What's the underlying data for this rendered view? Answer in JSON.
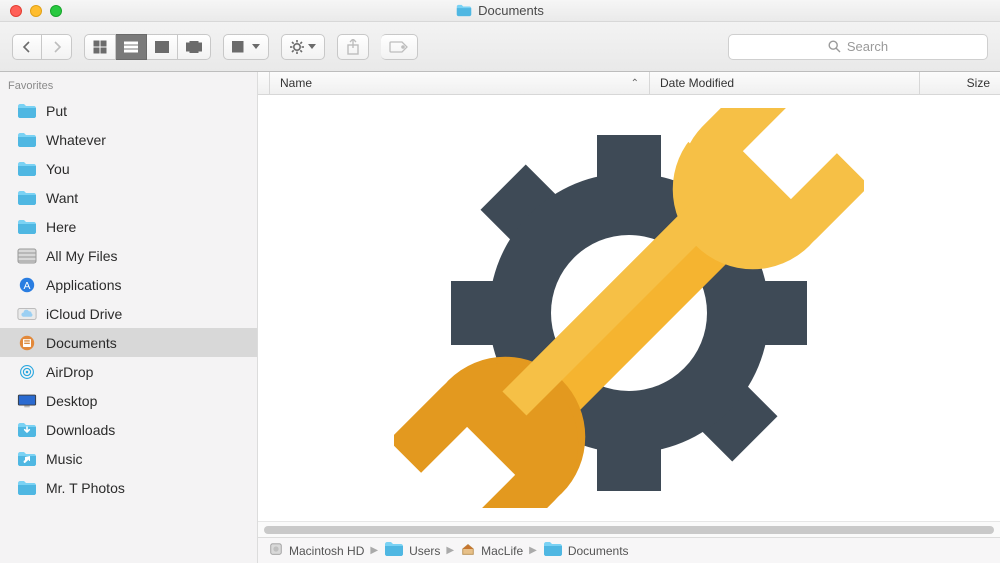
{
  "window": {
    "title": "Documents"
  },
  "search": {
    "placeholder": "Search"
  },
  "columns": {
    "name": "Name",
    "date": "Date Modified",
    "size": "Size"
  },
  "sidebar": {
    "header": "Favorites",
    "items": [
      {
        "label": "Put",
        "icon": "folder-blue",
        "selected": false
      },
      {
        "label": "Whatever",
        "icon": "folder-blue",
        "selected": false
      },
      {
        "label": "You",
        "icon": "folder-blue",
        "selected": false
      },
      {
        "label": "Want",
        "icon": "folder-blue",
        "selected": false
      },
      {
        "label": "Here",
        "icon": "folder-blue",
        "selected": false
      },
      {
        "label": "All My Files",
        "icon": "allfiles",
        "selected": false
      },
      {
        "label": "Applications",
        "icon": "applications",
        "selected": false
      },
      {
        "label": "iCloud Drive",
        "icon": "icloud",
        "selected": false
      },
      {
        "label": "Documents",
        "icon": "documents",
        "selected": true
      },
      {
        "label": "AirDrop",
        "icon": "airdrop",
        "selected": false
      },
      {
        "label": "Desktop",
        "icon": "desktop",
        "selected": false
      },
      {
        "label": "Downloads",
        "icon": "downloads",
        "selected": false
      },
      {
        "label": "Music",
        "icon": "music",
        "selected": false
      },
      {
        "label": "Mr. T Photos",
        "icon": "folder-blue",
        "selected": false
      }
    ]
  },
  "pathbar": [
    {
      "label": "Macintosh HD",
      "icon": "hdd"
    },
    {
      "label": "Users",
      "icon": "folder-mini"
    },
    {
      "label": "MacLife",
      "icon": "home"
    },
    {
      "label": "Documents",
      "icon": "folder-mini"
    }
  ],
  "colors": {
    "folder_light": "#7ad2f4",
    "folder_dark": "#4fb7e2",
    "accent_orange": "#f0a223",
    "gear_dark": "#3e4a56"
  }
}
